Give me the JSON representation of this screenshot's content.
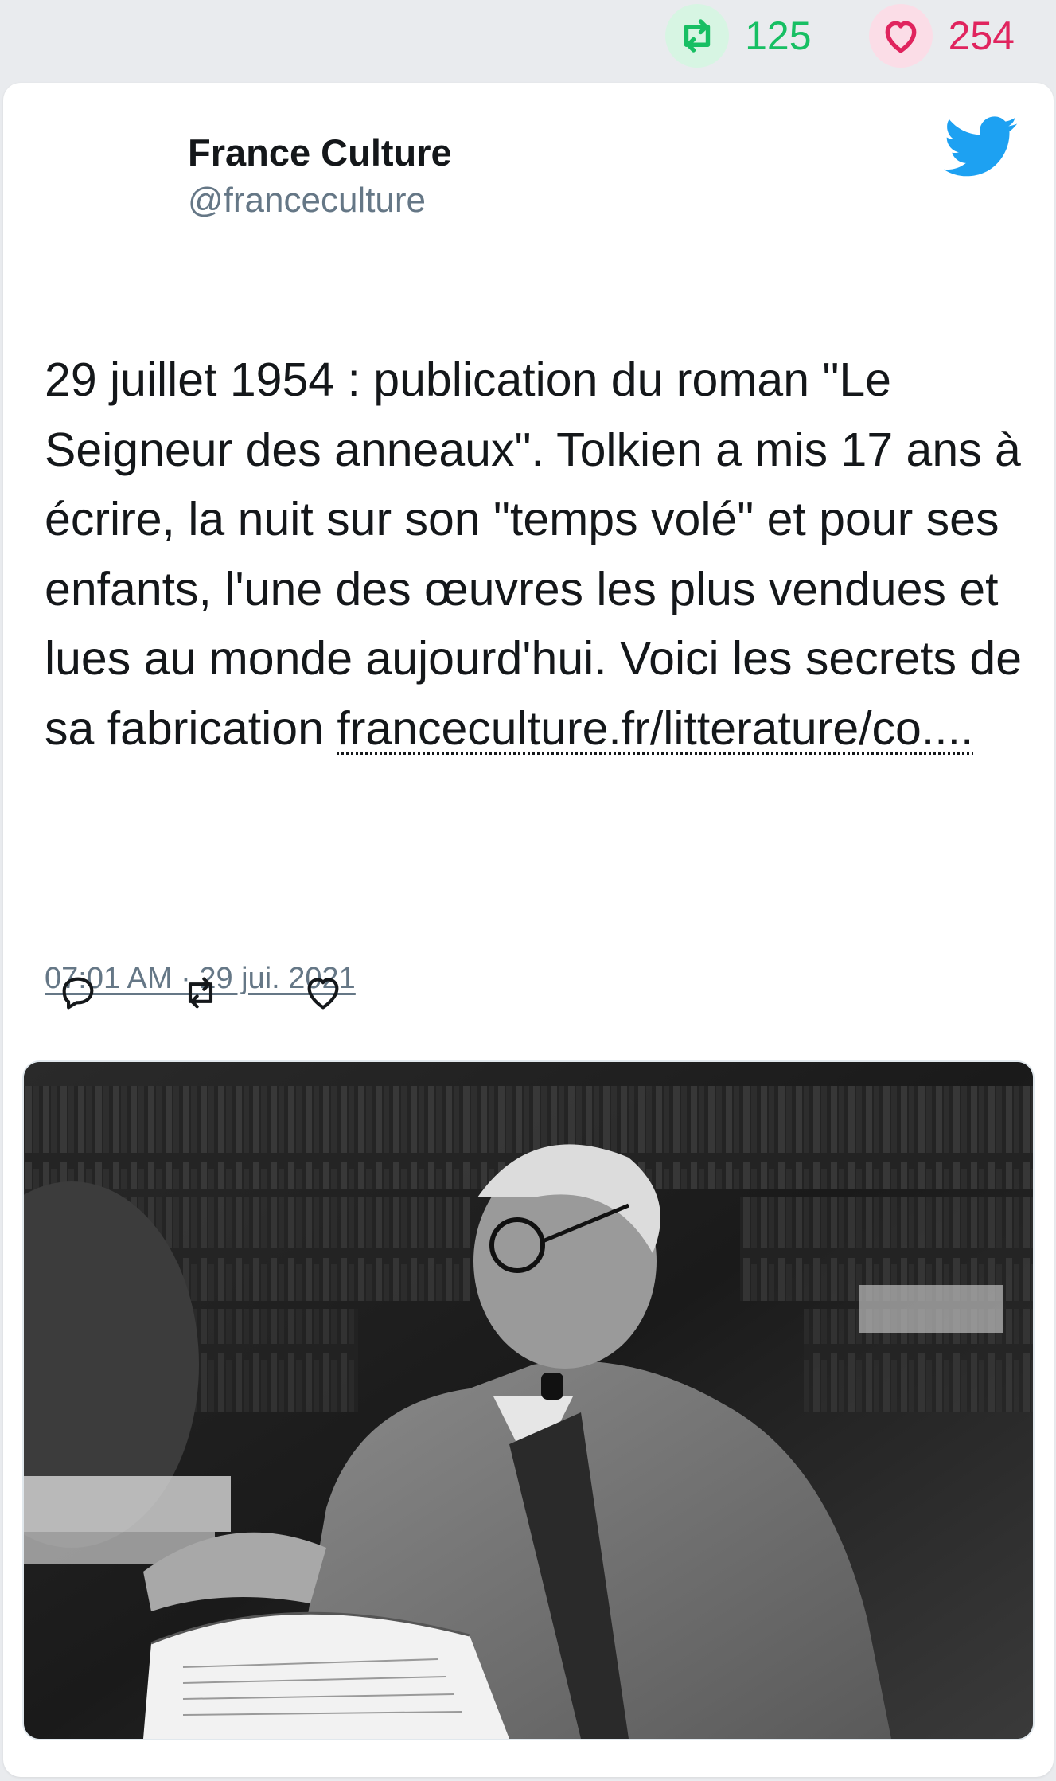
{
  "stats": {
    "retweets": "125",
    "likes": "254",
    "retweet_icon": "retweet-icon",
    "like_icon": "heart-icon"
  },
  "tweet": {
    "author_name": "France Culture",
    "author_handle": "@franceculture",
    "text": "29 juillet 1954 : publication du roman \"Le Seigneur des anneaux\". Tolkien a mis 17 ans à écrire, la nuit sur son \"temps volé\" et pour ses enfants, l'une des œuvres les plus vendues et lues au monde aujourd'hui. Voici les secrets de sa fabrication",
    "link": "franceculture.fr/litterature/co....",
    "timestamp": "07:01 AM · 29 jui. 2021"
  },
  "actions": [
    "reply-icon",
    "retweet-icon",
    "heart-icon"
  ],
  "colors": {
    "background": "#e9ebee",
    "card": "#ffffff",
    "retweet_green": "#17bf63",
    "like_red": "#e0245e",
    "twitter_blue": "#1da1f2",
    "muted_text": "#657786"
  }
}
